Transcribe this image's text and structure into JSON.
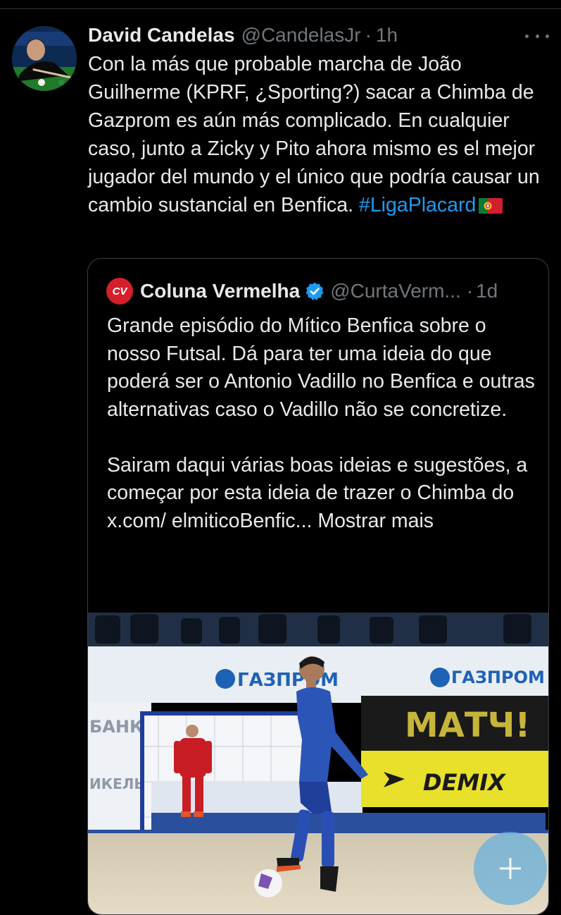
{
  "tweet": {
    "author_name": "David Candelas",
    "author_handle": "@CandelasJr",
    "separator": "·",
    "time": "1h",
    "text": "Con la más que probable marcha de João Guilherme (KPRF, ¿Sporting?) sacar a Chimba de Gazprom es aún más complicado. En cualquier caso, junto a Zicky y Pito ahora mismo es el mejor jugador del mundo y el único que podría causar un cambio sustancial en Benfica.",
    "hashtag": "#LigaPlacard",
    "flag_icon": "portugal-flag-icon",
    "more_icon": "more-dots-icon"
  },
  "quote": {
    "logo_text": "CV",
    "author_name": "Coluna Vermelha",
    "verified_icon": "verified-badge-icon",
    "author_handle": "@CurtaVerm...",
    "separator": "·",
    "time": "1d",
    "paragraph_1": "Grande episódio do Mítico Benfica sobre o nosso Futsal. Dá para ter uma ideia do que poderá ser o Antonio Vadillo no Benfica e outras alternativas caso o Vadillo não se concretize.",
    "paragraph_2": "Sairam daqui várias boas ideias e sugestões, a começar por esta ideia de trazer o Chimba do x.com/ elmiticoBenfic...",
    "show_more": "Mostrar mais",
    "media": {
      "banner_brand": "ГАЗПРОМ",
      "banner_brand_right": "ГАЗПРОМ",
      "sign_match": "МАТЧ!",
      "sign_demix": "DEMIX",
      "sign_left": "БАНК",
      "sign_left_lower": "ИКЕЛЬ"
    }
  },
  "compose_button": {
    "icon": "plus-icon"
  },
  "colors": {
    "background": "#000000",
    "text": "#e7e9ea",
    "muted": "#71767b",
    "link": "#1d9bf0",
    "border": "#3a3f44",
    "accent_red": "#d3202b"
  }
}
